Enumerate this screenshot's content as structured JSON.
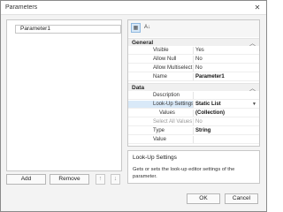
{
  "window": {
    "title": "Parameters",
    "close_glyph": "✕"
  },
  "parameters": [
    {
      "label": "Parameter1"
    }
  ],
  "buttons": {
    "add": "Add",
    "remove": "Remove",
    "move_up": "↑",
    "move_down": "↓",
    "ok": "OK",
    "cancel": "Cancel"
  },
  "toolbar": {
    "categorized_icon": "categorized-icon",
    "alphabetical_icon": "alphabetical-icon",
    "categorized_glyph": "▦",
    "alphabetical_glyph": "A↓"
  },
  "properties": {
    "general": {
      "label": "General",
      "rows": [
        {
          "name": "Visible",
          "value": "Yes"
        },
        {
          "name": "Allow Null",
          "value": "No"
        },
        {
          "name": "Allow Multiselect",
          "value": "No"
        },
        {
          "name": "Name",
          "value": "Parameter1"
        }
      ]
    },
    "data": {
      "label": "Data",
      "rows": [
        {
          "name": "Description",
          "value": ""
        },
        {
          "name": "Look-Up Settings",
          "value": "Static List"
        },
        {
          "name": "Values",
          "value": "(Collection)"
        },
        {
          "name": "Select All Values",
          "value": "No"
        },
        {
          "name": "Type",
          "value": "String"
        },
        {
          "name": "Value",
          "value": ""
        }
      ]
    }
  },
  "description": {
    "title": "Look-Up Settings",
    "text": "Gets or sets the look-up editor settings of the parameter."
  },
  "colors": {
    "selection": "#d9e9f8",
    "accent_border": "#8fb8e0"
  }
}
